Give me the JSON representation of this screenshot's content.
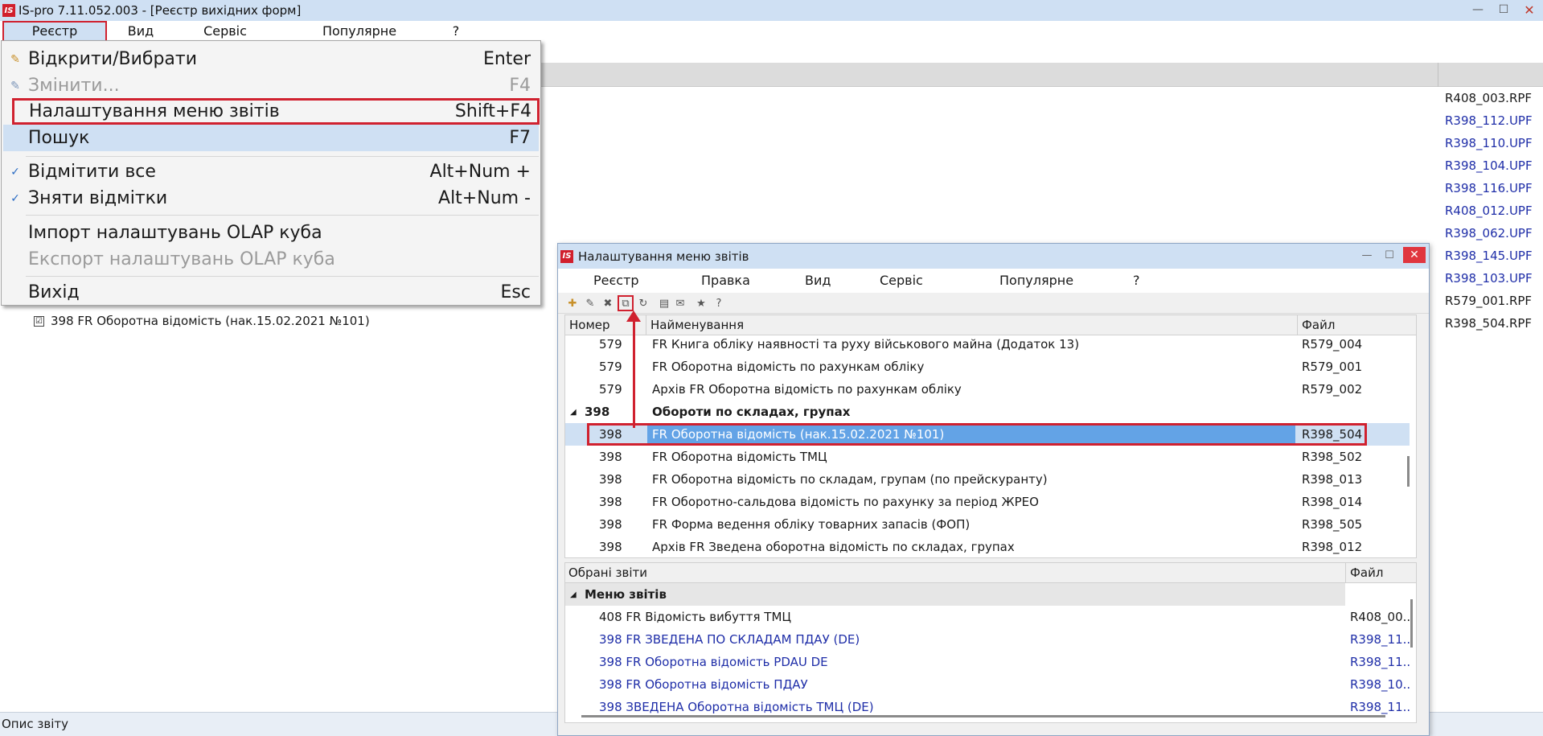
{
  "window": {
    "title": "IS-pro 7.11.052.003 - [Реєстр вихідних форм]",
    "icon_text": "IS",
    "controls": [
      "minimize-icon",
      "maximize-icon",
      "close-icon"
    ]
  },
  "menubar": {
    "items": [
      "Реєстр",
      "Вид",
      "Сервіс",
      "Популярне",
      "?"
    ]
  },
  "dropdown": {
    "items": [
      {
        "label": "Відкрити/Вибрати",
        "shortcut": "Enter",
        "icon": "open-icon",
        "state": "normal"
      },
      {
        "label": "Змінити...",
        "shortcut": "F4",
        "icon": "edit-icon",
        "state": "disabled"
      },
      {
        "label": "Налаштування меню звітів",
        "shortcut": "Shift+F4",
        "icon": "",
        "state": "boxed"
      },
      {
        "label": "Пошук",
        "shortcut": "F7",
        "icon": "",
        "state": "highlighted"
      },
      {
        "label": "Відмітити все",
        "shortcut": "Alt+Num +",
        "icon": "check-all-icon",
        "state": "normal"
      },
      {
        "label": "Зняти відмітки",
        "shortcut": "Alt+Num -",
        "icon": "uncheck-icon",
        "state": "normal"
      },
      {
        "label": "Імпорт налаштувань OLAP куба",
        "shortcut": "",
        "icon": "",
        "state": "normal"
      },
      {
        "label": "Експорт налаштувань OLAP куба",
        "shortcut": "",
        "icon": "",
        "state": "disabled"
      },
      {
        "label": "Вихід",
        "shortcut": "Esc",
        "icon": "",
        "state": "normal"
      }
    ]
  },
  "background": {
    "tree_item": "398 FR Оборотна відомість (нак.15.02.2021 №101)",
    "checkbox_mark": "☑",
    "files": [
      {
        "name": "R408_003.RPF",
        "color": "#1a1a1a"
      },
      {
        "name": "R398_112.UPF",
        "color": "#1f2ea8"
      },
      {
        "name": "R398_110.UPF",
        "color": "#1f2ea8"
      },
      {
        "name": "R398_104.UPF",
        "color": "#1f2ea8"
      },
      {
        "name": "R398_116.UPF",
        "color": "#1f2ea8"
      },
      {
        "name": "R408_012.UPF",
        "color": "#1f2ea8"
      },
      {
        "name": "R398_062.UPF",
        "color": "#1f2ea8"
      },
      {
        "name": "R398_145.UPF",
        "color": "#1f2ea8"
      },
      {
        "name": "R398_103.UPF",
        "color": "#1f2ea8"
      },
      {
        "name": "R579_001.RPF",
        "color": "#1a1a1a"
      },
      {
        "name": "R398_504.RPF",
        "color": "#1a1a1a"
      }
    ]
  },
  "statusbar": {
    "text": "Опис звіту"
  },
  "dialog": {
    "title": "Налаштування меню звітів",
    "menu": [
      "Реєстр",
      "Правка",
      "Вид",
      "Сервіс",
      "Популярне",
      "?"
    ],
    "toolbar": [
      "new-icon",
      "edit-icon",
      "delete-icon",
      "copy-icon",
      "refresh-icon",
      "document-icon",
      "mail-icon",
      "star-icon",
      "help-icon"
    ],
    "upper": {
      "columns": [
        "Номер",
        "Найменування",
        "Файл"
      ],
      "rows": [
        {
          "num": "579",
          "name": "FR Книга обліку наявності та руху військового майна (Додаток 13)",
          "file": "R579_004",
          "type": "row"
        },
        {
          "num": "579",
          "name": "FR Оборотна відомість по рахункам обліку",
          "file": "R579_001",
          "type": "row"
        },
        {
          "num": "579",
          "name": "Архів FR Оборотна відомість по рахункам обліку",
          "file": "R579_002",
          "type": "row"
        },
        {
          "num": "398",
          "name": "Обороти по складах, групах",
          "file": "",
          "type": "group"
        },
        {
          "num": "398",
          "name": "FR Оборотна відомість (нак.15.02.2021 №101)",
          "file": "R398_504",
          "type": "selected"
        },
        {
          "num": "398",
          "name": "FR Оборотна відомість ТМЦ",
          "file": "R398_502",
          "type": "row"
        },
        {
          "num": "398",
          "name": "FR Оборотна відомість по складам, групам (по прейскуранту)",
          "file": "R398_013",
          "type": "row"
        },
        {
          "num": "398",
          "name": "FR Оборотно-сальдова відомість по рахунку за період ЖРЕО",
          "file": "R398_014",
          "type": "row"
        },
        {
          "num": "398",
          "name": "FR Форма ведення обліку товарних запасів (ФОП)",
          "file": "R398_505",
          "type": "row"
        },
        {
          "num": "398",
          "name": "Архів FR Зведена оборотна відомість по складах, групах",
          "file": "R398_012",
          "type": "row"
        }
      ]
    },
    "lower": {
      "columns": [
        "Обрані звіти",
        "Файл"
      ],
      "group": "Меню звітів",
      "rows": [
        {
          "name": "408 FR Відомість вибуття ТМЦ",
          "file": "R408_00..",
          "blue": false
        },
        {
          "name": "398 FR ЗВЕДЕНА ПО СКЛАДАМ ПДАУ (DE)",
          "file": "R398_11..",
          "blue": true
        },
        {
          "name": "398 FR Оборотна відомість PDAU DE",
          "file": "R398_11..",
          "blue": true
        },
        {
          "name": "398 FR Оборотна відомість ПДАУ",
          "file": "R398_10..",
          "blue": true
        },
        {
          "name": "398 ЗВЕДЕНА Оборотна відомість ТМЦ (DE)",
          "file": "R398_11..",
          "blue": true
        }
      ]
    }
  },
  "colors": {
    "accent_red": "#d0212f",
    "titlebar": "#cfe0f3",
    "selection": "#63a3e6",
    "link_blue": "#1f2ea8"
  }
}
